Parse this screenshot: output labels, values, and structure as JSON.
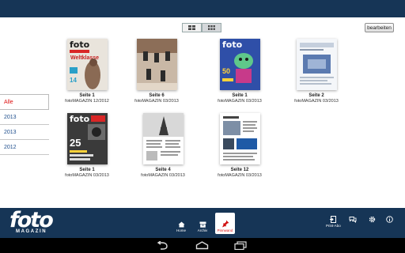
{
  "toolbar": {
    "edit_label": "bearbeiten",
    "view_toggle": [
      "list-view-icon",
      "grid-view-icon"
    ]
  },
  "years": [
    {
      "label": "Alle",
      "active": true
    },
    {
      "label": "2013",
      "active": false
    },
    {
      "label": "2013",
      "active": false
    },
    {
      "label": "2012",
      "active": false
    }
  ],
  "issues": [
    {
      "page": "Seite 1",
      "magazine": "fotoMAGAZIN 12/2012",
      "cover": "foto-weltklasse"
    },
    {
      "page": "Seite 6",
      "magazine": "fotoMAGAZIN 03/2013",
      "cover": "shoes-photo"
    },
    {
      "page": "Seite 1",
      "magazine": "fotoMAGAZIN 03/2013",
      "cover": "foto-alien"
    },
    {
      "page": "Seite 2",
      "magazine": "fotoMAGAZIN 03/2013",
      "cover": "ad-page"
    },
    {
      "page": "Seite 1",
      "magazine": "fotoMAGAZIN 03/2013",
      "cover": "foto-25-tipps"
    },
    {
      "page": "Seite 4",
      "magazine": "fotoMAGAZIN 03/2013",
      "cover": "eiffel-page"
    },
    {
      "page": "Seite 12",
      "magazine": "fotoMAGAZIN 03/2013",
      "cover": "article-page"
    }
  ],
  "bottombar": {
    "logo": "foto",
    "logo_sub": "MAGAZIN",
    "home_label": "Home",
    "archive_label": "Archiv",
    "pinnwand_label": "Pinnwand",
    "print_label": "Print-Abo"
  },
  "colors": {
    "bar": "#163556",
    "accent": "#d11111",
    "link": "#1d4d8c"
  }
}
